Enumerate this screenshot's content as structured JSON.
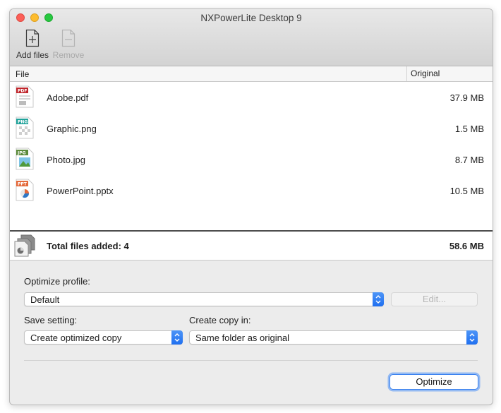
{
  "window": {
    "title": "NXPowerLite Desktop 9"
  },
  "toolbar": {
    "add_files": "Add files",
    "remove": "Remove"
  },
  "list": {
    "columns": {
      "file": "File",
      "original": "Original"
    },
    "files": [
      {
        "name": "Adobe.pdf",
        "size": "37.9 MB",
        "type": "PDF",
        "color": "#c0272d"
      },
      {
        "name": "Graphic.png",
        "size": "1.5 MB",
        "type": "PNG",
        "color": "#21a29a"
      },
      {
        "name": "Photo.jpg",
        "size": "8.7 MB",
        "type": "JPG",
        "color": "#5b8a3a"
      },
      {
        "name": "PowerPoint.pptx",
        "size": "10.5 MB",
        "type": "PPT",
        "color": "#e4693a"
      }
    ],
    "total_label": "Total files added: 4",
    "total_size": "58.6 MB"
  },
  "settings": {
    "optimize_profile_label": "Optimize profile:",
    "optimize_profile_value": "Default",
    "edit_button": "Edit...",
    "save_setting_label": "Save setting:",
    "save_setting_value": "Create optimized copy",
    "create_copy_label": "Create copy in:",
    "create_copy_value": "Same folder as original"
  },
  "actions": {
    "optimize": "Optimize"
  },
  "colors": {
    "accent": "#1f6ff0",
    "window_bg": "#ececec"
  }
}
